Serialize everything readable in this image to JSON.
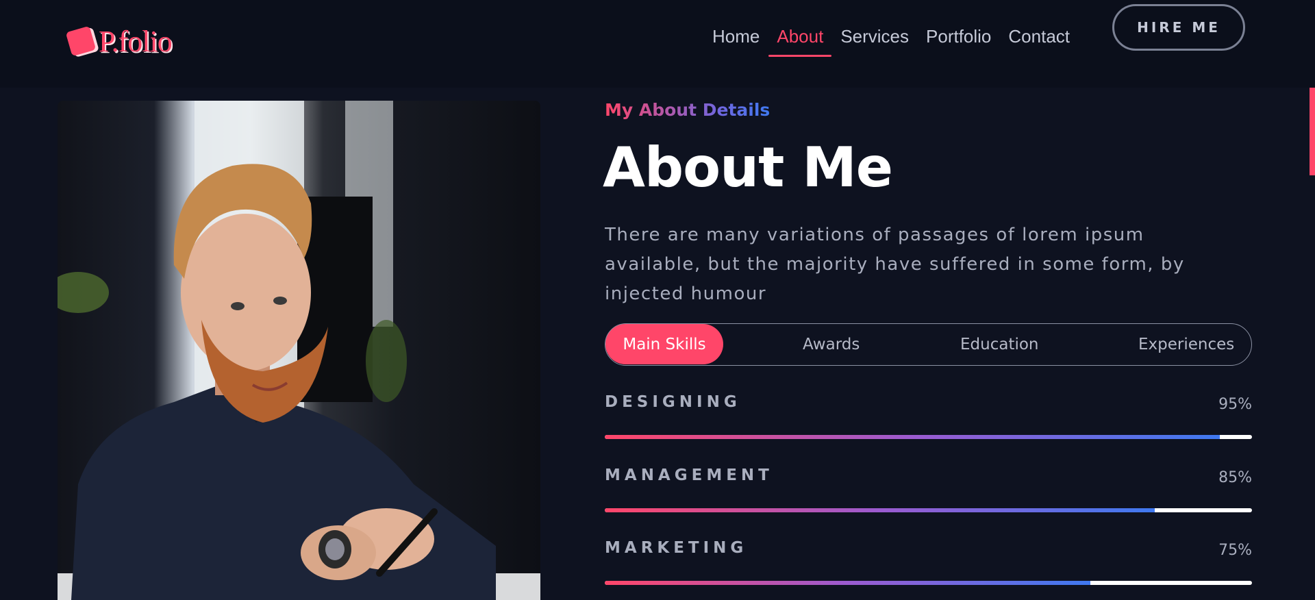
{
  "brand": {
    "logo_text": "P.folio",
    "accent": "#ff4669"
  },
  "nav": {
    "items": [
      {
        "label": "Home",
        "active": false
      },
      {
        "label": "About",
        "active": true
      },
      {
        "label": "Services",
        "active": false
      },
      {
        "label": "Portfolio",
        "active": false
      },
      {
        "label": "Contact",
        "active": false
      }
    ],
    "cta": "HIRE ME"
  },
  "about": {
    "subtitle": "My About Details",
    "title": "About Me",
    "description": "There are many variations of passages of lorem ipsum available, but the majority have suffered in some form, by injected humour"
  },
  "tabs": [
    {
      "label": "Main Skills",
      "active": true
    },
    {
      "label": "Awards",
      "active": false
    },
    {
      "label": "Education",
      "active": false
    },
    {
      "label": "Experiences",
      "active": false
    }
  ],
  "skills": [
    {
      "name": "DESIGNING",
      "percent_label": "95%",
      "value": 95
    },
    {
      "name": "MANAGEMENT",
      "percent_label": "85%",
      "value": 85
    },
    {
      "name": "MARKETING",
      "percent_label": "75%",
      "value": 75
    }
  ],
  "colors": {
    "background": "#0e1220",
    "header": "#0b0f1b",
    "accent": "#ff4669",
    "gradient_end": "#3f79f0"
  }
}
